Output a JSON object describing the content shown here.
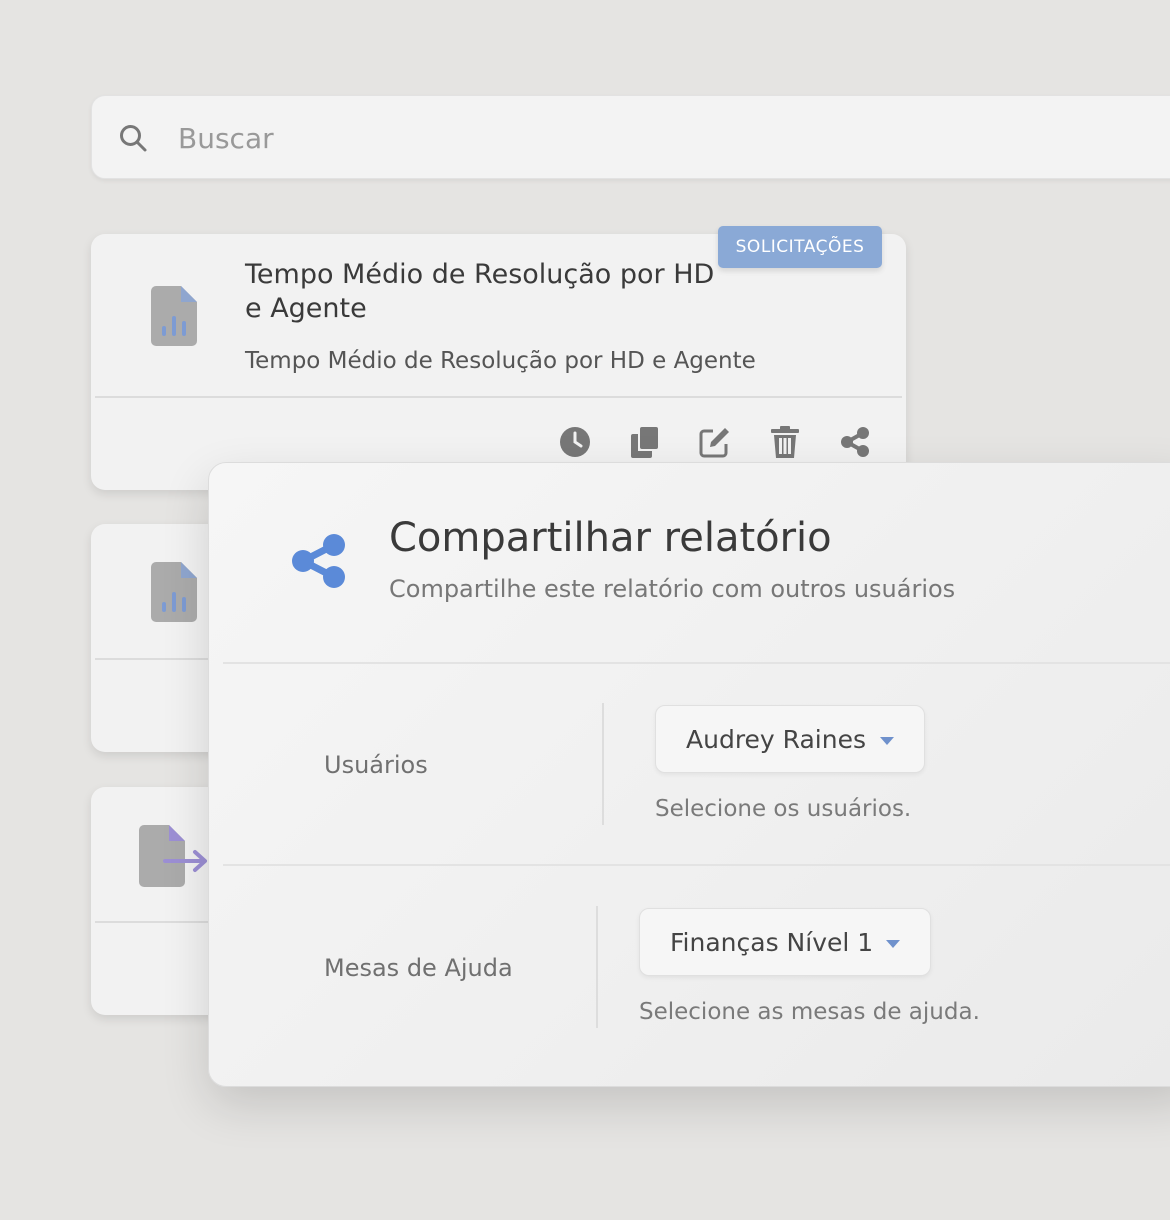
{
  "search": {
    "placeholder": "Buscar",
    "icon": "search-icon"
  },
  "cards": [
    {
      "title": "Tempo Médio de Resolução por HD e Agente",
      "description": "Tempo Médio de Resolução por HD e Agente",
      "tag": "SOLICITAÇÕES",
      "icon": "chart-document-icon",
      "actions": [
        "clock-icon",
        "copy-icon",
        "edit-icon",
        "trash-icon",
        "share-icon"
      ]
    },
    {
      "icon": "chart-document-icon"
    },
    {
      "icon": "export-document-icon"
    }
  ],
  "modal": {
    "icon": "share-icon",
    "title": "Compartilhar relatório",
    "subtitle": "Compartilhe este relatório com outros usuários",
    "fields": [
      {
        "label": "Usuários",
        "value": "Audrey Raines",
        "hint": "Selecione os usuários."
      },
      {
        "label": "Mesas de Ajuda",
        "value": "Finanças Nível 1",
        "hint": "Selecione as mesas de ajuda."
      }
    ]
  },
  "colors": {
    "background": "#e5e4e2",
    "accent": "#5b8ad8",
    "tag": "#8aa9d6",
    "icon_gray": "#a9a9a9",
    "export_purple": "#9c8fd4"
  }
}
